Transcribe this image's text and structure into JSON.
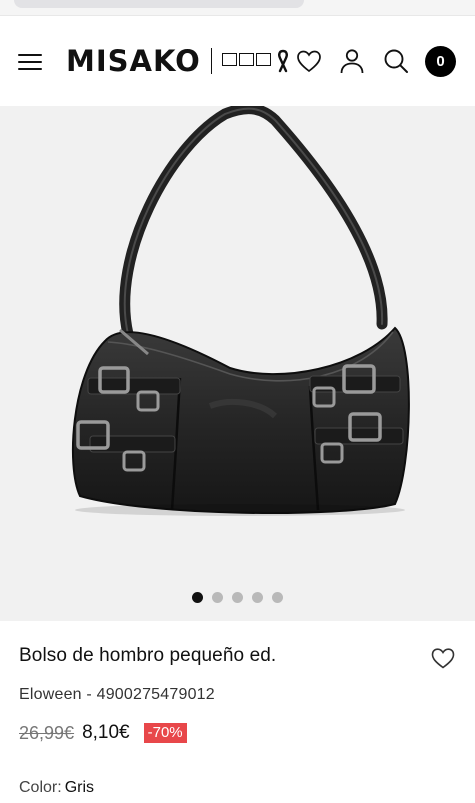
{
  "header": {
    "brand": "MISAKO",
    "cart_count": "0"
  },
  "gallery": {
    "image_count": 5,
    "active_index": 0
  },
  "product": {
    "title": "Bolso de hombro pequeño ed.",
    "brand_line": "Eloween - 4900275479012",
    "old_price": "26,99€",
    "new_price": "8,10€",
    "discount": "-70%",
    "color_label": "Color:",
    "color_value": "Gris"
  },
  "colors": {
    "accent_discount": "#e8474a",
    "badge": "#000000",
    "gallery_bg": "#f1f1f1"
  },
  "icons": [
    "menu-icon",
    "ribbon-icon",
    "heart-icon",
    "user-icon",
    "search-icon",
    "cart-icon",
    "heart-outline-icon"
  ]
}
